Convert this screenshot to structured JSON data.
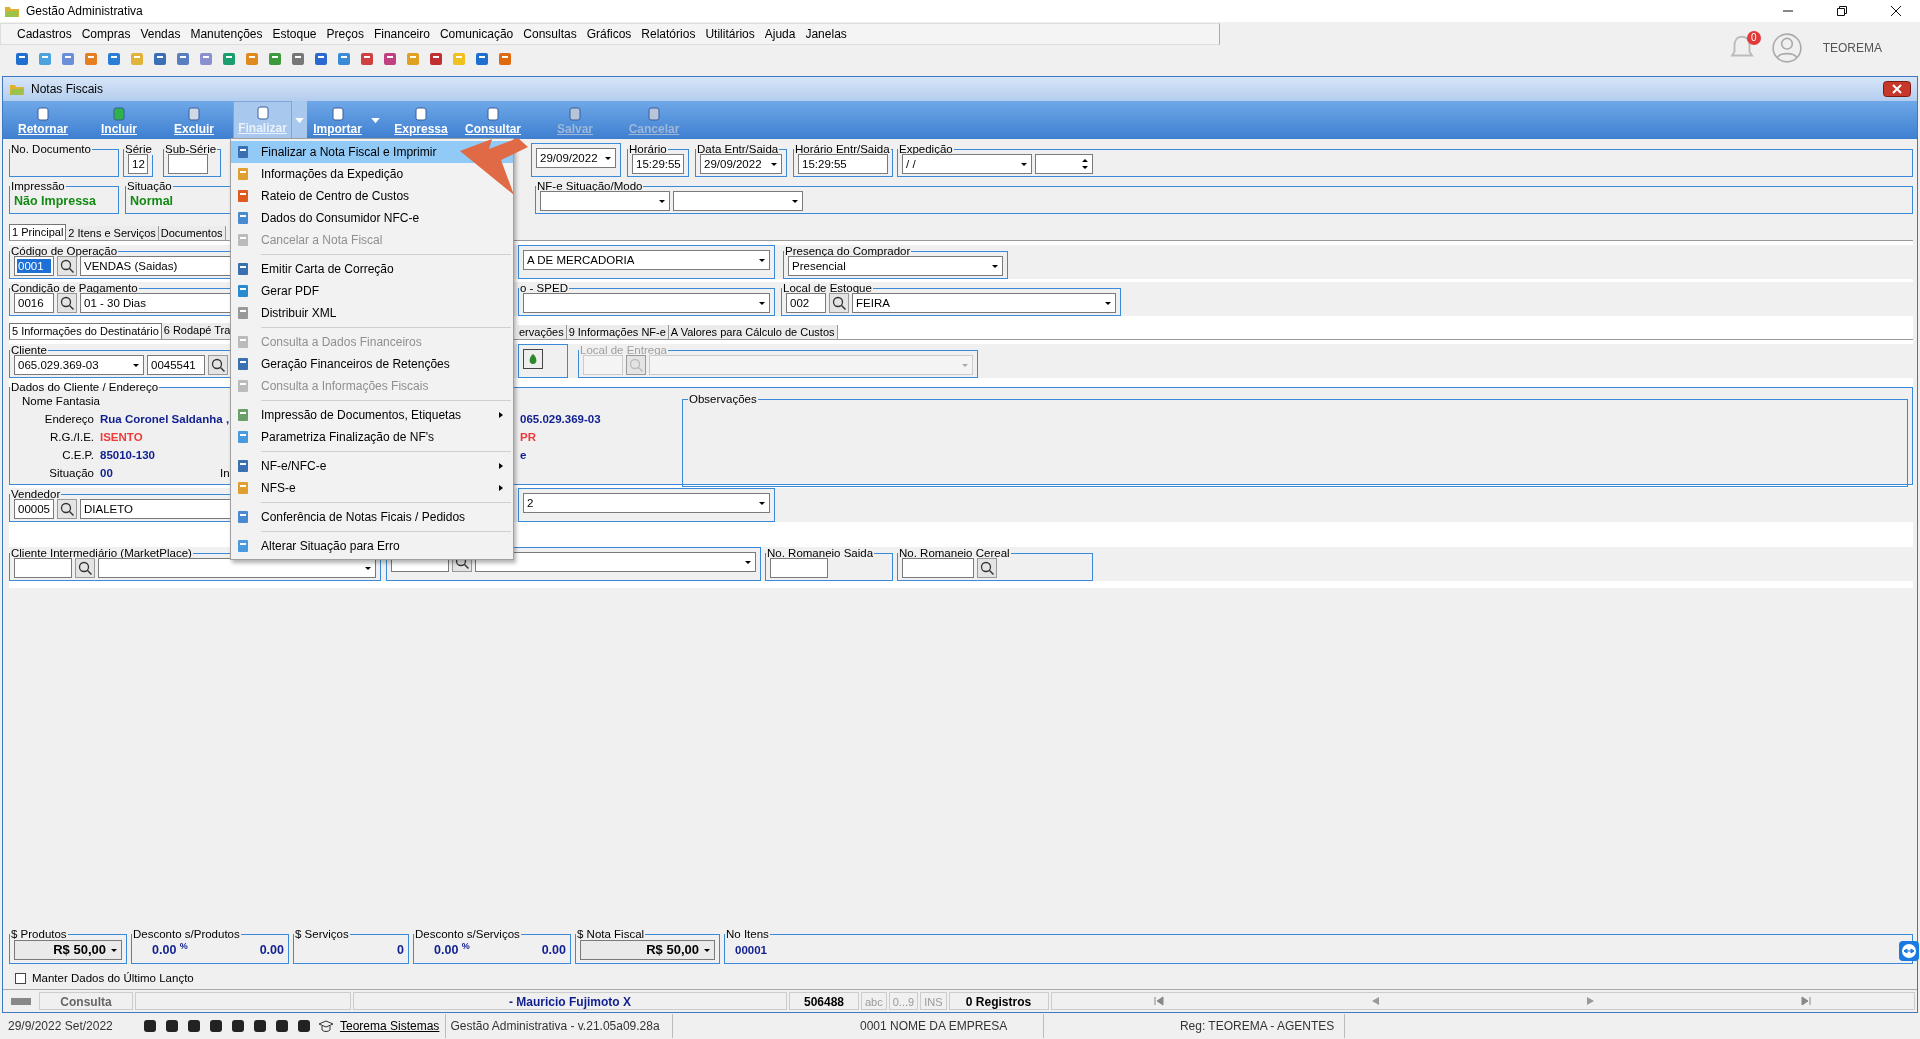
{
  "window": {
    "title": "Gestão Administrativa"
  },
  "menubar": [
    "Cadastros",
    "Compras",
    "Vendas",
    "Manutenções",
    "Estoque",
    "Preços",
    "Financeiro",
    "Comunicação",
    "Consultas",
    "Gráficos",
    "Relatórios",
    "Utilitários",
    "Ajuda",
    "Janelas"
  ],
  "user": {
    "name": "TEOREMA",
    "notifications": "0"
  },
  "child_window": {
    "title": "Notas Fiscais"
  },
  "toolbar": [
    {
      "label": "Retornar",
      "disabled": false,
      "selected": false,
      "dropdown": false
    },
    {
      "label": "Incluir",
      "disabled": false,
      "selected": false,
      "dropdown": false
    },
    {
      "label": "Excluir",
      "disabled": false,
      "selected": false,
      "dropdown": false
    },
    {
      "label": "Finalizar",
      "disabled": false,
      "selected": true,
      "dropdown": true
    },
    {
      "label": "Importar",
      "disabled": false,
      "selected": false,
      "dropdown": true
    },
    {
      "label": "Expressa",
      "disabled": false,
      "selected": false,
      "dropdown": false
    },
    {
      "label": "Consultar",
      "disabled": false,
      "selected": false,
      "dropdown": false
    },
    {
      "label": "Salvar",
      "disabled": true,
      "selected": false,
      "dropdown": false
    },
    {
      "label": "Cancelar",
      "disabled": true,
      "selected": false,
      "dropdown": false
    }
  ],
  "header": {
    "fields": [
      {
        "label": "No. Documento"
      },
      {
        "label": "Série",
        "controls": [
          {
            "kind": "box",
            "value": "12"
          }
        ]
      },
      {
        "label": "Sub-Série",
        "controls": [
          {
            "kind": "code"
          }
        ]
      },
      {
        "controls": [
          {
            "kind": "select",
            "value": "29/09/2022"
          }
        ]
      },
      {
        "label": "Horário",
        "controls": [
          {
            "kind": "box",
            "value": "15:29:55"
          }
        ]
      },
      {
        "label": "Data Entr/Saida",
        "controls": [
          {
            "kind": "select",
            "value": "29/09/2022"
          }
        ]
      },
      {
        "label": "Horário Entr/Saida",
        "controls": [
          {
            "kind": "box",
            "value": "15:29:55"
          }
        ]
      },
      {
        "label": "Expedição",
        "controls": [
          {
            "kind": "combo",
            "value": " / /"
          },
          {
            "kind": "spin"
          }
        ]
      }
    ],
    "status": [
      {
        "label": "Impressão",
        "controls": [
          {
            "kind": "status",
            "value": "Não Impressa"
          }
        ]
      },
      {
        "label": "Situação",
        "controls": [
          {
            "kind": "status",
            "value": "Normal"
          }
        ]
      },
      {
        "label": "NF-e Situação/Modo",
        "controls": [
          {
            "kind": "combo"
          },
          {
            "kind": "combo"
          }
        ]
      }
    ]
  },
  "tabs": [
    {
      "label": "1 Principal",
      "selected": true
    },
    {
      "label": "2 Itens e Serviços",
      "selected": false
    },
    {
      "label": "Documentos",
      "selected": false
    }
  ],
  "principal": {
    "rows": [
      [
        {
          "label": "Código de Operação",
          "controls": [
            {
              "kind": "code",
              "value": "0001",
              "selected": true
            },
            {
              "kind": "lookup"
            },
            {
              "kind": "text",
              "value": "VENDAS (Saidas)"
            }
          ]
        },
        {
          "controls": [
            {
              "kind": "select",
              "value": "A DE MERCADORIA"
            }
          ]
        },
        {
          "label": "Presença do Comprador",
          "controls": [
            {
              "kind": "select",
              "value": "Presencial"
            }
          ]
        }
      ],
      [
        {
          "label": "Condição de Pagamento",
          "controls": [
            {
              "kind": "code",
              "value": "0016",
              "selected": false
            },
            {
              "kind": "lookup"
            },
            {
              "kind": "text",
              "value": "01 - 30 Dias"
            }
          ]
        },
        {
          "label": "o - SPED",
          "controls": [
            {
              "kind": "select"
            }
          ]
        },
        {
          "label": "Local de Estoque",
          "controls": [
            {
              "kind": "code",
              "value": "002",
              "selected": false
            },
            {
              "kind": "lookup"
            },
            {
              "kind": "select",
              "value": "FEIRA"
            }
          ]
        }
      ]
    ]
  },
  "subtabs": [
    {
      "label": "5 Informações do Destinatário",
      "selected": true
    },
    {
      "label": "6 Rodapé Tra",
      "selected": false
    },
    {
      "label": "ervações",
      "selected": false
    },
    {
      "label": "9 Informações NF-e",
      "selected": false
    },
    {
      "label": "A Valores para Cálculo de Custos",
      "selected": false
    }
  ],
  "destinatario": {
    "cliente_row": [
      {
        "label": "Cliente",
        "disabled": false,
        "controls": [
          {
            "kind": "combo",
            "value": "065.029.369-03"
          },
          {
            "kind": "code",
            "value": "0045541"
          },
          {
            "kind": "lookup"
          }
        ]
      },
      {
        "disabled": false,
        "controls": [
          {
            "kind": "money"
          }
        ]
      },
      {
        "label": "Local de Entrega",
        "disabled": true,
        "controls": [
          {
            "kind": "code"
          },
          {
            "kind": "lookup"
          },
          {
            "kind": "select"
          }
        ]
      }
    ],
    "dados": {
      "label": "Dados do Cliente / Endereço",
      "lines": [
        {
          "label": "Nome Fantasia",
          "alert": false
        },
        {
          "label": "Endereço",
          "value": "Rua Coronel Saldanha ,",
          "right": "065.029.369-03",
          "alert": false
        },
        {
          "label": "R.G./I.E.",
          "value": "ISENTO",
          "right": "PR",
          "alert": true
        },
        {
          "label": "C.E.P.",
          "value": "85010-130",
          "right": "e",
          "alert": false
        },
        {
          "label": "Situação",
          "value": "00",
          "extra": "In",
          "alert": false
        }
      ],
      "observacoes": {
        "label": "Observações"
      }
    },
    "rows": [
      [
        {
          "label": "Vendedor",
          "controls": [
            {
              "kind": "code",
              "value": "00005"
            },
            {
              "kind": "lookup"
            },
            {
              "kind": "box",
              "value": "DIALETO"
            }
          ]
        },
        {
          "controls": [
            {
              "kind": "select",
              "value": "2"
            }
          ]
        }
      ],
      [
        {
          "label": "Cliente Intermediário (MarketPlace)",
          "controls": [
            {
              "kind": "code"
            },
            {
              "kind": "lookup"
            },
            {
              "kind": "select"
            }
          ]
        },
        {
          "controls": [
            {
              "kind": "code"
            },
            {
              "kind": "lookup"
            },
            {
              "kind": "select"
            }
          ]
        },
        {
          "label": "No. Romaneio Saida",
          "controls": [
            {
              "kind": "code"
            }
          ]
        },
        {
          "label": "No. Romaneio Cereal",
          "controls": [
            {
              "kind": "wide"
            },
            {
              "kind": "lookup"
            }
          ]
        }
      ]
    ]
  },
  "totals": [
    {
      "label": "$ Produtos",
      "controls": [
        {
          "kind": "amount",
          "value": "R$ 50,00"
        }
      ]
    },
    {
      "label": "Desconto s/Produtos",
      "controls": [
        {
          "kind": "percent",
          "value": "0.00",
          "unit": "%"
        },
        {
          "kind": "number",
          "value": "0.00"
        }
      ]
    },
    {
      "label": "$ Serviços",
      "controls": [
        {
          "kind": "number",
          "value": "0"
        }
      ]
    },
    {
      "label": "Desconto s/Serviços",
      "controls": [
        {
          "kind": "percent",
          "value": "0.00",
          "unit": "%"
        },
        {
          "kind": "number",
          "value": "0.00"
        }
      ]
    },
    {
      "label": "$ Nota Fiscal",
      "controls": [
        {
          "kind": "amount",
          "value": "R$ 50,00"
        }
      ]
    },
    {
      "label": "No Itens",
      "controls": [
        {
          "kind": "count",
          "value": "00001"
        }
      ]
    }
  ],
  "keep_data": {
    "label": "Manter Dados do Último Lançto",
    "checked": false
  },
  "status_bar": {
    "mode": "Consulta",
    "user": "- Mauricio Fujimoto X",
    "code": "506488",
    "indicators": [
      "abc",
      "0...9",
      "INS"
    ],
    "records": "0 Registros"
  },
  "footer": {
    "date": "29/9/2022 Set/2022",
    "link": "Teorema Sistemas",
    "version": "Gestão Administrativa - v.21.05a09.28a",
    "company": "0001 NOME DA EMPRESA",
    "registration": "Reg: TEOREMA - AGENTES"
  },
  "menu": [
    {
      "kind": "item",
      "label": "Finalizar a Nota Fiscal e Imprimir",
      "selected": true,
      "disabled": false,
      "submenu": false
    },
    {
      "kind": "item",
      "label": "Informações da Expedição",
      "selected": false,
      "disabled": false,
      "submenu": false
    },
    {
      "kind": "item",
      "label": "Rateio de Centro de Custos",
      "selected": false,
      "disabled": false,
      "submenu": false
    },
    {
      "kind": "item",
      "label": "Dados do Consumidor NFC-e",
      "selected": false,
      "disabled": false,
      "submenu": false
    },
    {
      "kind": "item",
      "label": "Cancelar a Nota Fiscal",
      "selected": false,
      "disabled": true,
      "submenu": false
    },
    {
      "kind": "separator"
    },
    {
      "kind": "item",
      "label": "Emitir Carta de Correção",
      "selected": false,
      "disabled": false,
      "submenu": false
    },
    {
      "kind": "item",
      "label": "Gerar PDF",
      "selected": false,
      "disabled": false,
      "submenu": false
    },
    {
      "kind": "item",
      "label": "Distribuir XML",
      "selected": false,
      "disabled": false,
      "submenu": false
    },
    {
      "kind": "separator"
    },
    {
      "kind": "item",
      "label": "Consulta a Dados Financeiros",
      "selected": false,
      "disabled": true,
      "submenu": false
    },
    {
      "kind": "item",
      "label": "Geração Financeiros de Retenções",
      "selected": false,
      "disabled": false,
      "submenu": false
    },
    {
      "kind": "item",
      "label": "Consulta a Informações Fiscais",
      "selected": false,
      "disabled": true,
      "submenu": false
    },
    {
      "kind": "separator"
    },
    {
      "kind": "item",
      "label": "Impressão de Documentos, Etiquetas",
      "selected": false,
      "disabled": false,
      "submenu": true
    },
    {
      "kind": "item",
      "label": "Parametriza Finalização de NF's",
      "selected": false,
      "disabled": false,
      "submenu": false
    },
    {
      "kind": "separator"
    },
    {
      "kind": "item",
      "label": "NF-e/NFC-e",
      "selected": false,
      "disabled": false,
      "submenu": true
    },
    {
      "kind": "item",
      "label": "NFS-e",
      "selected": false,
      "disabled": false,
      "submenu": true
    },
    {
      "kind": "separator"
    },
    {
      "kind": "item",
      "label": "Conferência de Notas Ficais / Pedidos",
      "selected": false,
      "disabled": false,
      "submenu": false
    },
    {
      "kind": "separator"
    },
    {
      "kind": "item",
      "label": "Alterar Situação para Erro",
      "selected": false,
      "disabled": false,
      "submenu": false
    }
  ]
}
